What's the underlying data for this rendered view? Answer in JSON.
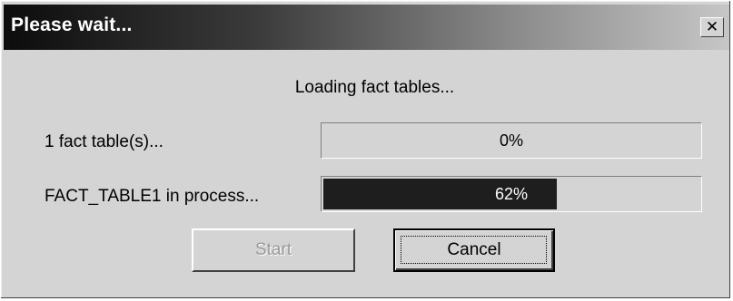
{
  "window": {
    "title": "Please wait...",
    "close_symbol": "✕",
    "close_icon": "close-icon"
  },
  "message": "Loading fact tables...",
  "progress_rows": [
    {
      "label": "1 fact table(s)...",
      "percent_text": "0%",
      "fraction": 0.0
    },
    {
      "label": "FACT_TABLE1 in process...",
      "percent_text": "62%",
      "fraction": 0.62
    }
  ],
  "buttons": {
    "start": {
      "label": "Start",
      "enabled": false
    },
    "cancel": {
      "label": "Cancel",
      "enabled": true
    }
  },
  "colors": {
    "dialog_bg": "#d4d4d4",
    "progress_fill": "#1e1e1e",
    "title_gradient_start": "#0c0c0c",
    "title_gradient_end": "#c6c6c6"
  }
}
